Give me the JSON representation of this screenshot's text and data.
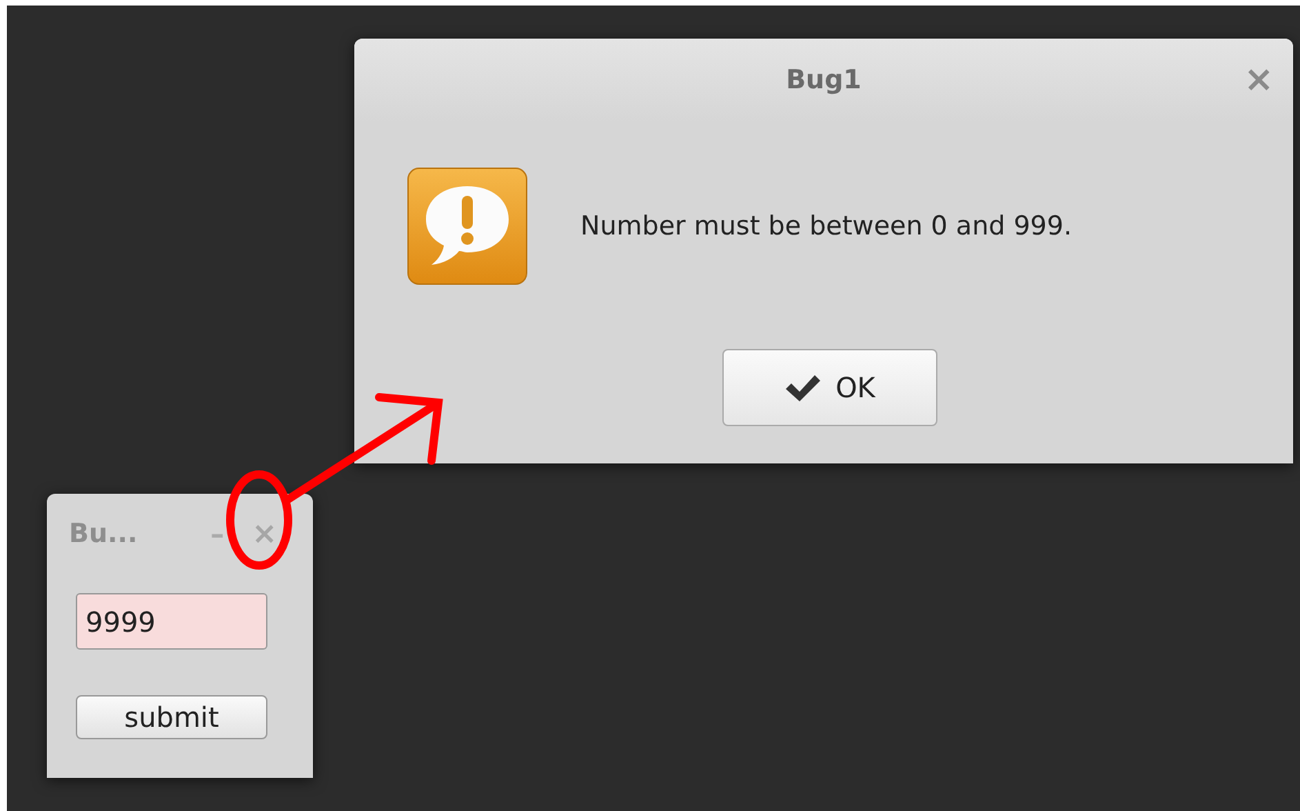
{
  "dialog": {
    "title": "Bug1",
    "close": "×",
    "active": true,
    "message": "Number must be between 0 and 999.",
    "button": {
      "label": "OK"
    }
  },
  "main_window": {
    "title": "Bu...",
    "minimize": "–",
    "close": "×",
    "active": false,
    "field": {
      "value": "9999",
      "invalid": true
    },
    "button": {
      "label": "submit"
    }
  }
}
